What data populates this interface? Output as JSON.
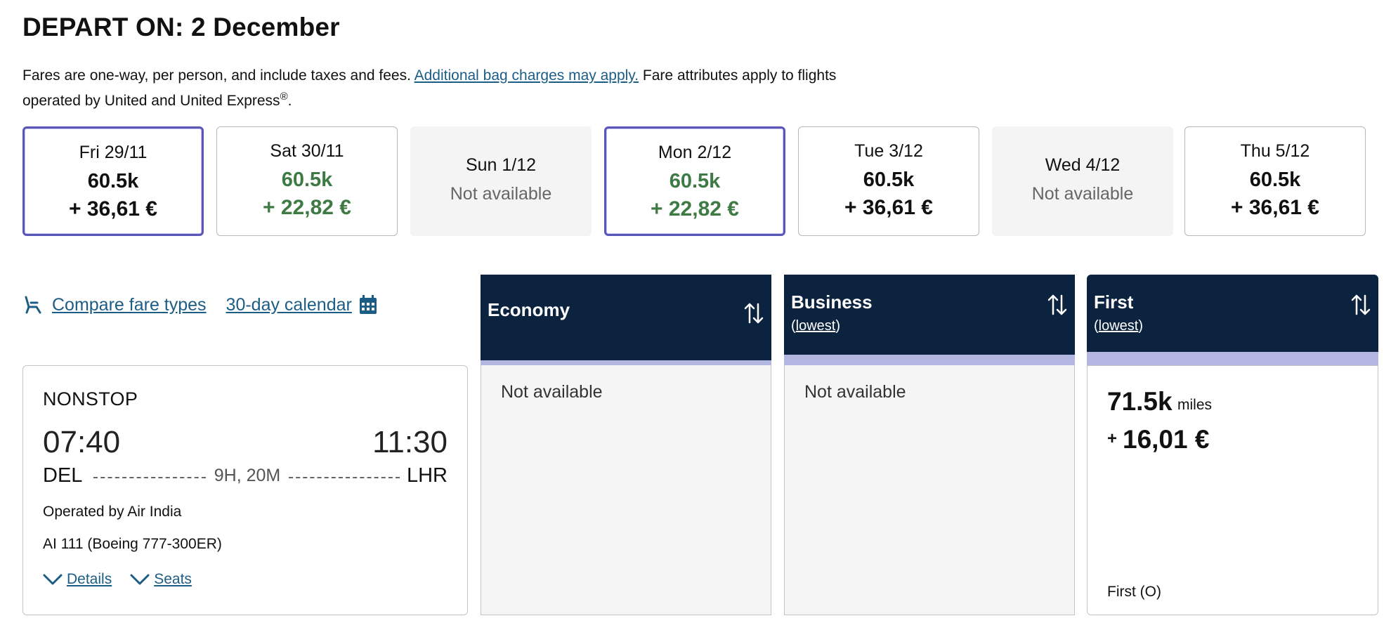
{
  "header": {
    "title": "DEPART ON: 2 December",
    "note_before": "Fares are one-way, per person, and include taxes and fees. ",
    "note_link": "Additional bag charges may apply.",
    "note_after": " Fare attributes apply to flights operated by United and United Express",
    "note_reg": "®",
    "note_end": "."
  },
  "dates": [
    {
      "label": "Fri 29/11",
      "miles": "60.5k",
      "fee": "+ 36,61 €",
      "status": "selected"
    },
    {
      "label": "Sat 30/11",
      "miles": "60.5k",
      "fee": "+ 22,82 €",
      "status": "lowest"
    },
    {
      "label": "Sun 1/12",
      "na": "Not available",
      "status": "unavailable"
    },
    {
      "label": "Mon 2/12",
      "miles": "60.5k",
      "fee": "+ 22,82 €",
      "status": "selected-lowest"
    },
    {
      "label": "Tue 3/12",
      "miles": "60.5k",
      "fee": "+ 36,61 €",
      "status": "normal"
    },
    {
      "label": "Wed 4/12",
      "na": "Not available",
      "status": "unavailable"
    },
    {
      "label": "Thu 5/12",
      "miles": "60.5k",
      "fee": "+ 36,61 €",
      "status": "normal"
    }
  ],
  "tools": {
    "compare_label": "Compare fare types",
    "calendar_label": "30-day calendar"
  },
  "flight": {
    "stops": "NONSTOP",
    "depart_time": "07:40",
    "arrive_time": "11:30",
    "origin": "DEL",
    "destination": "LHR",
    "duration": "9H, 20M",
    "operated_by": "Operated by Air India",
    "flight_number": "AI 111 (Boeing 777-300ER)",
    "details_label": "Details",
    "seats_label": "Seats"
  },
  "cabins": {
    "economy": {
      "name": "Economy",
      "status": "Not available"
    },
    "business": {
      "name": "Business",
      "sub_open": "(",
      "sub_link": "lowest",
      "sub_close": ")",
      "status": "Not available"
    },
    "first": {
      "name": "First",
      "sub_open": "(",
      "sub_link": "lowest",
      "sub_close": ")",
      "miles": "71.5k",
      "miles_unit": "miles",
      "plus": "+",
      "fee": "16,01 €",
      "fare_code": "First (O)"
    }
  },
  "colors": {
    "header_navy": "#0c2340",
    "lowest_band": "#b3b6e0",
    "selected_border": "#5a56b8",
    "lowest_green": "#3e7a44",
    "link_blue": "#1c5d86"
  },
  "icons": {
    "compare": "reclining-seat-icon",
    "calendar": "calendar-icon",
    "sort": "sort-arrows-icon",
    "expand": "chevron-down-icon"
  }
}
